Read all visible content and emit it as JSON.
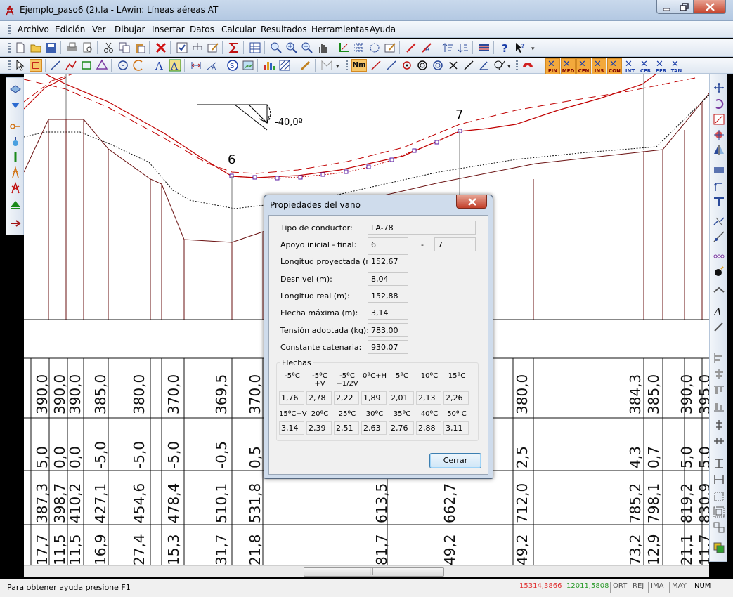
{
  "window": {
    "title": "Ejemplo_paso6 (2).la - LAwin: Líneas aéreas AT",
    "icon": "pylon-icon"
  },
  "menu": [
    "Archivo",
    "Edición",
    "Ver",
    "Dibujar",
    "Insertar",
    "Datos",
    "Calcular",
    "Resultados",
    "Herramientas",
    "Ayuda"
  ],
  "snap_buttons": [
    "FIN",
    "MED",
    "CEN",
    "INS",
    "CON",
    "INT",
    "CER",
    "PER",
    "TAN"
  ],
  "toolbar_text": {
    "nm": "Nm"
  },
  "drawing": {
    "angle_label": "-40,0º",
    "support_labels": [
      "6",
      "7"
    ],
    "table_rows": [
      [
        "390,0",
        "390,0",
        "390,0",
        "385,0",
        "380,0",
        "370,0",
        "369,5",
        "370,0",
        "380,0",
        "384,3",
        "385,0",
        "390,0",
        "395,0"
      ],
      [
        "5,0",
        "0,0",
        "0,0",
        "-5,0",
        "-5,0",
        "-5,0",
        "-0,5",
        "0,5",
        "2,5",
        "4,3",
        "0,7",
        "5,0",
        "5,0"
      ],
      [
        "387,3",
        "398,7",
        "410,2",
        "427,1",
        "454,6",
        "478,4",
        "510,1",
        "531,8",
        "613,5",
        "662,7",
        "712,0",
        "785,2",
        "798,1",
        "819,2",
        "830,9"
      ],
      [
        "17,7",
        "11,5",
        "11,5",
        "16,9",
        "27,4",
        "15,3",
        "31,7",
        "21,8",
        "81,7",
        "49,2",
        "49,2",
        "73,2",
        "12,9",
        "21,1",
        "11,7"
      ]
    ]
  },
  "dialog": {
    "title": "Propiedades del vano",
    "fields": [
      {
        "label": "Tipo de conductor:",
        "value": "LA-78"
      },
      {
        "label": "Apoyo inicial - final:",
        "value": "6",
        "value2": "7",
        "separator": "-"
      },
      {
        "label": "Longitud proyectada (m):",
        "value": "152,67"
      },
      {
        "label": "Desnivel (m):",
        "value": "8,04"
      },
      {
        "label": "Longitud real (m):",
        "value": "152,88"
      },
      {
        "label": "Flecha máxima (m):",
        "value": "3,14"
      },
      {
        "label": "Tensión adoptada (kg):",
        "value": "783,00"
      },
      {
        "label": "Constante catenaria:",
        "value": "930,07"
      }
    ],
    "flechas": {
      "title": "Flechas",
      "row1_headers": [
        "-5ºC",
        "-5ºC\n+V",
        "-5ºC\n+1/2V",
        "0ºC+H",
        "5ºC",
        "10ºC",
        "15ºC"
      ],
      "row1_values": [
        "1,76",
        "2,78",
        "2,22",
        "1,89",
        "2,01",
        "2,13",
        "2,26"
      ],
      "row2_headers": [
        "15ºC+V",
        "20ºC",
        "25ºC",
        "30ºC",
        "35ºC",
        "40ºC",
        "50º C"
      ],
      "row2_values": [
        "3,14",
        "2,39",
        "2,51",
        "2,63",
        "2,76",
        "2,88",
        "3,11"
      ]
    },
    "close_button": "Cerrar"
  },
  "status": {
    "help": "Para obtener ayuda presione F1",
    "x": "15314,3866",
    "y": "12011,5808",
    "indicators": [
      "ORT",
      "REJ",
      "IMA",
      "MAY",
      "NUM"
    ]
  },
  "colors": {
    "conductor": "#c00000",
    "dialog_frame": "#cfdcec",
    "snap_active": "#f3a93c"
  }
}
